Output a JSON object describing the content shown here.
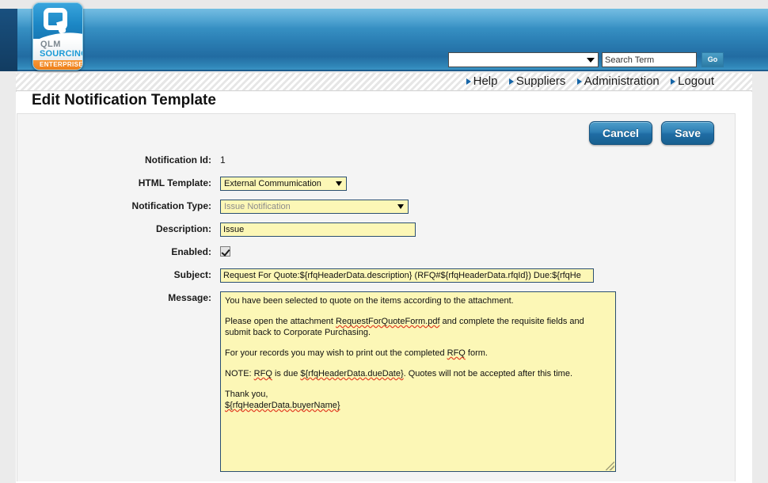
{
  "header": {
    "logo": {
      "mark": "Q",
      "line1": "QLM",
      "line2": "SOURCING",
      "line3": "ENTERPRISE"
    },
    "search": {
      "category_value": "",
      "term_value": "Search Term",
      "term_placeholder": "Search Term",
      "go_label": "Go"
    },
    "nav_items": [
      {
        "label": "Help"
      },
      {
        "label": "Suppliers"
      },
      {
        "label": "Administration"
      },
      {
        "label": "Logout"
      }
    ]
  },
  "page": {
    "title": "Edit Notification Template"
  },
  "actions": {
    "cancel_label": "Cancel",
    "save_label": "Save"
  },
  "form": {
    "notification_id": {
      "label": "Notification Id:",
      "value": "1"
    },
    "html_template": {
      "label": "HTML Template:",
      "value": "External Commumication"
    },
    "notification_type": {
      "label": "Notification Type:",
      "value": "Issue Notification"
    },
    "description": {
      "label": "Description:",
      "value": "Issue"
    },
    "enabled": {
      "label": "Enabled:",
      "checked": true
    },
    "subject": {
      "label": "Subject:",
      "value": "Request For Quote:${rfqHeaderData.description} (RFQ#${rfqHeaderData.rfqId}) Due:${rfqHe"
    },
    "message": {
      "label": "Message:",
      "paragraphs": [
        {
          "lines": [
            {
              "parts": [
                {
                  "text": "You have been selected to quote on the items according to the attachment.",
                  "spell": false
                }
              ]
            }
          ]
        },
        {
          "lines": [
            {
              "parts": [
                {
                  "text": "Please open the attachment ",
                  "spell": false
                },
                {
                  "text": "RequestForQuoteForm.pdf",
                  "spell": true
                },
                {
                  "text": " and complete the requisite fields and",
                  "spell": false
                }
              ]
            },
            {
              "parts": [
                {
                  "text": "submit back to Corporate Purchasing.",
                  "spell": false
                }
              ]
            }
          ]
        },
        {
          "lines": [
            {
              "parts": [
                {
                  "text": "For your records you may wish to print out the completed ",
                  "spell": false
                },
                {
                  "text": "RFQ",
                  "spell": true
                },
                {
                  "text": " form.",
                  "spell": false
                }
              ]
            }
          ]
        },
        {
          "lines": [
            {
              "parts": [
                {
                  "text": "NOTE: ",
                  "spell": false
                },
                {
                  "text": "RFQ",
                  "spell": true
                },
                {
                  "text": " is due ",
                  "spell": false
                },
                {
                  "text": "${rfqHeaderData.dueDate}",
                  "spell": true
                },
                {
                  "text": ". Quotes will not be accepted after this time.",
                  "spell": false
                }
              ]
            }
          ]
        },
        {
          "lines": [
            {
              "parts": [
                {
                  "text": "Thank you,",
                  "spell": false
                }
              ]
            },
            {
              "parts": [
                {
                  "text": "${rfqHeaderData.buyerName}",
                  "spell": true
                }
              ]
            }
          ]
        }
      ]
    }
  },
  "colors": {
    "brand_blue": "#2b7fb4",
    "brand_orange": "#ec7a14",
    "field_yellow": "#fcf7b6",
    "field_border": "#2b4f70",
    "spellcheck_red": "#e23b22"
  }
}
